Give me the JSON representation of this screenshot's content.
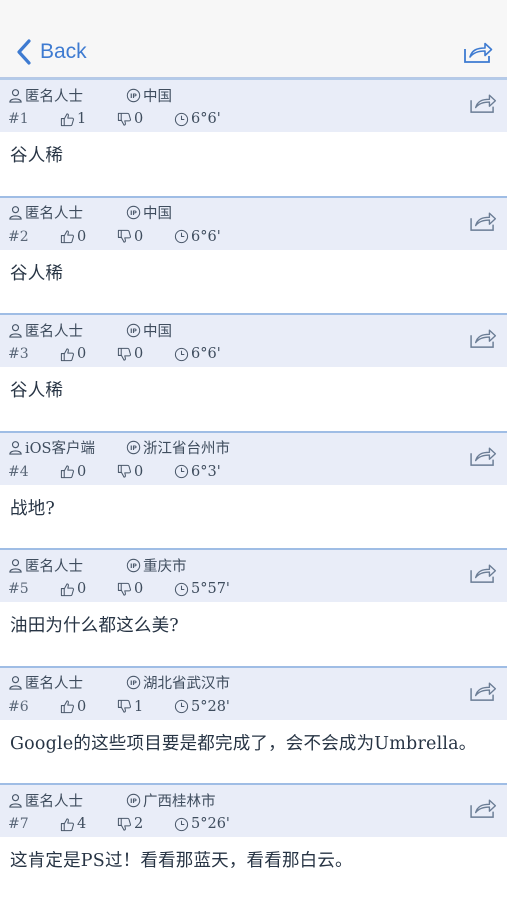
{
  "nav": {
    "back_label": "Back",
    "back_icon": "chevron-left-icon",
    "share_icon": "share-icon"
  },
  "colors": {
    "accent": "#3e7bd1",
    "meta_bg": "#e9edf8",
    "divider": "#9fbde5"
  },
  "posts": [
    {
      "user": "匿名人士",
      "location": "中国",
      "floor": "#1",
      "likes": "1",
      "dislikes": "0",
      "time": "6°6'",
      "content": "谷人稀"
    },
    {
      "user": "匿名人士",
      "location": "中国",
      "floor": "#2",
      "likes": "0",
      "dislikes": "0",
      "time": "6°6'",
      "content": "谷人稀"
    },
    {
      "user": "匿名人士",
      "location": "中国",
      "floor": "#3",
      "likes": "0",
      "dislikes": "0",
      "time": "6°6'",
      "content": "谷人稀"
    },
    {
      "user": "iOS客户端",
      "location": "浙江省台州市",
      "floor": "#4",
      "likes": "0",
      "dislikes": "0",
      "time": "6°3'",
      "content": "战地?"
    },
    {
      "user": "匿名人士",
      "location": "重庆市",
      "floor": "#5",
      "likes": "0",
      "dislikes": "0",
      "time": "5°57'",
      "content": "油田为什么都这么美?"
    },
    {
      "user": "匿名人士",
      "location": "湖北省武汉市",
      "floor": "#6",
      "likes": "0",
      "dislikes": "1",
      "time": "5°28'",
      "content": "Google的这些项目要是都完成了，会不会成为Umbrella。"
    },
    {
      "user": "匿名人士",
      "location": "广西桂林市",
      "floor": "#7",
      "likes": "4",
      "dislikes": "2",
      "time": "5°26'",
      "content": "这肯定是PS过！看看那蓝天，看看那白云。"
    }
  ]
}
